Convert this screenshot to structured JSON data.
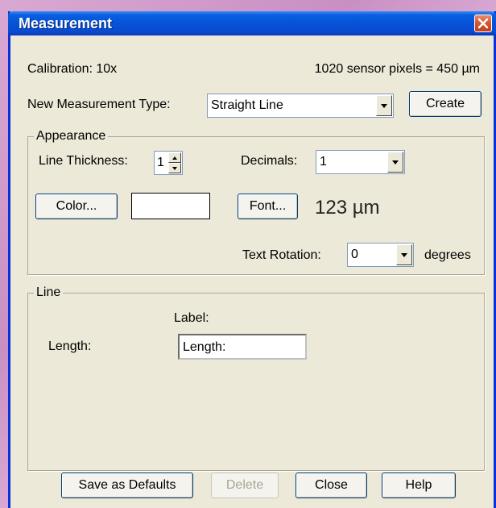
{
  "window": {
    "title": "Measurement",
    "close_icon": "close-icon"
  },
  "calibration": {
    "label": "Calibration: 10x",
    "scale": "1020 sensor pixels = 450 µm"
  },
  "new_type": {
    "label": "New Measurement Type:",
    "value": "Straight Line",
    "create_label": "Create"
  },
  "appearance": {
    "group_label": "Appearance",
    "thickness_label": "Line Thickness:",
    "thickness_value": "1",
    "decimals_label": "Decimals:",
    "decimals_value": "1",
    "color_label": "Color...",
    "color_swatch": "#ffffff",
    "font_label": "Font...",
    "sample_text": "123 µm",
    "rotation_label": "Text Rotation:",
    "rotation_value": "0",
    "rotation_units": "degrees"
  },
  "line": {
    "group_label": "Line",
    "label_header": "Label:",
    "length_label": "Length:",
    "length_value": "Length:"
  },
  "buttons": {
    "save_defaults": "Save as Defaults",
    "delete": "Delete",
    "close": "Close",
    "help": "Help"
  }
}
